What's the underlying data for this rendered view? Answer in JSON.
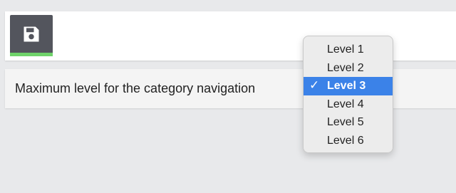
{
  "toolbar": {
    "save_button": {
      "icon": "floppy-disk-icon",
      "color": "#53555d",
      "accent_underline_color": "#6fd36a"
    }
  },
  "setting": {
    "label": "Maximum level for the category navigation",
    "select": {
      "options": [
        "Level 1",
        "Level 2",
        "Level 3",
        "Level 4",
        "Level 5",
        "Level 6"
      ],
      "selected_index": 2,
      "selected_value": "Level 3",
      "highlight_color": "#3b82e8",
      "check_glyph": "✓"
    }
  }
}
